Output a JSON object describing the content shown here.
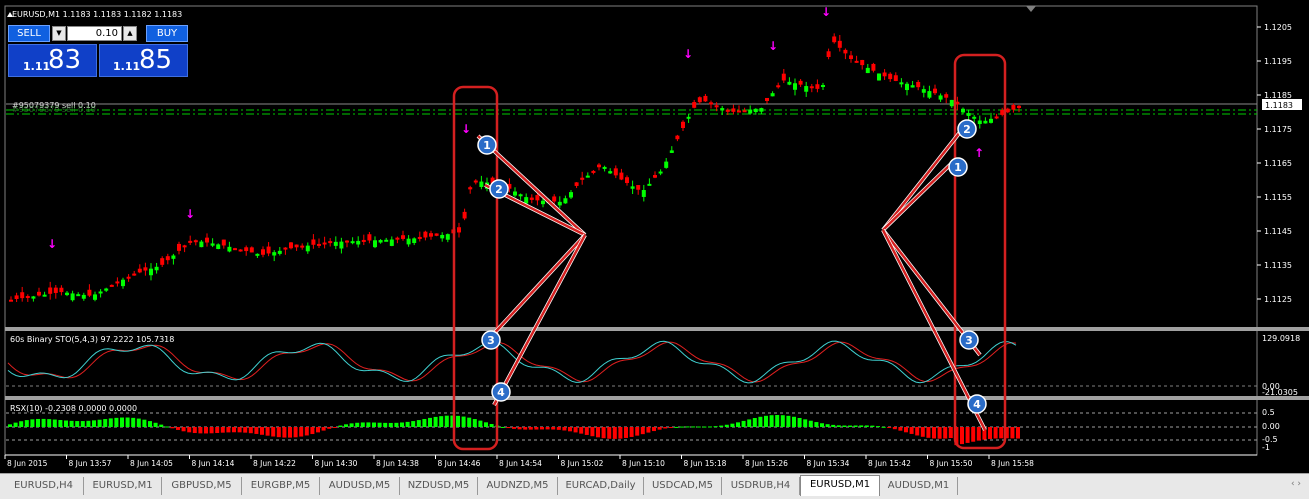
{
  "chart": {
    "symbol_info": "EURUSD,M1  1.1183 1.1183 1.1182 1.1183",
    "current_price": "1.1183",
    "price_axis": [
      "1.1205",
      "1.1195",
      "1.1185",
      "1.1175",
      "1.1165",
      "1.1155",
      "1.1145",
      "1.1135",
      "1.1125"
    ],
    "time_axis": [
      "8 Jun 2015",
      "8 Jun 13:57",
      "8 Jun 14:05",
      "8 Jun 14:14",
      "8 Jun 14:22",
      "8 Jun 14:30",
      "8 Jun 14:38",
      "8 Jun 14:46",
      "8 Jun 14:54",
      "8 Jun 15:02",
      "8 Jun 15:10",
      "8 Jun 15:18",
      "8 Jun 15:26",
      "8 Jun 15:34",
      "8 Jun 15:42",
      "8 Jun 15:50",
      "8 Jun 15:58"
    ],
    "order_line_label": "#95079379 sell 0.10",
    "colors": {
      "bull": "#00ff00",
      "bear": "#ff0000",
      "arrow": "#ff00ff",
      "level": "#00cc00",
      "stoch_main": "#40d0d0",
      "stoch_signal": "#e02020",
      "annotation": "#d42020",
      "badge": "#2a6cc8"
    }
  },
  "trade_panel": {
    "sell_label": "SELL",
    "buy_label": "BUY",
    "lot_value": "0.10",
    "sell_prefix": "1.11",
    "sell_big": "83",
    "buy_prefix": "1.11",
    "buy_big": "85"
  },
  "stochastic": {
    "title": "60s Binary STO(5,4,3) 97.2222 105.7318",
    "axis_top": "129.0918",
    "axis_zero": "0.00",
    "axis_bottom": "-21.0305"
  },
  "rsx": {
    "title": "RSX(10) -0.2308 0.0000 0.0000",
    "axis": [
      "0.5",
      "0.00",
      "-0.5",
      "-1"
    ]
  },
  "annotations": {
    "left": [
      "1",
      "2",
      "3",
      "4"
    ],
    "right": [
      "1",
      "2",
      "3",
      "4"
    ]
  },
  "tabs": [
    "EURUSD,H4",
    "EURUSD,M1",
    "GBPUSD,M5",
    "EURGBP,M5",
    "AUDUSD,M5",
    "NZDUSD,M5",
    "AUDNZD,M5",
    "EURCAD,Daily",
    "USDCAD,M5",
    "USDRUB,H4",
    "EURUSD,M1",
    "AUDUSD,M1"
  ],
  "active_tab_index": 10
}
